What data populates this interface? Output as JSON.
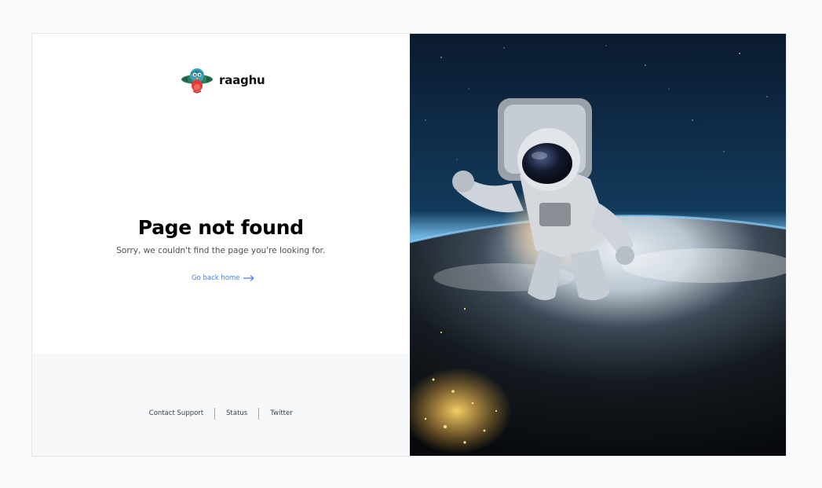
{
  "brand": {
    "name": "raaghu",
    "logo_icon": "parrot-mascot-logo"
  },
  "error": {
    "title": "Page not found",
    "message": "Sorry, we couldn't find the page you're looking for.",
    "home_link_label": "Go back home",
    "home_link_icon": "arrow-right-icon"
  },
  "footer": {
    "links": [
      {
        "label": "Contact Support"
      },
      {
        "label": "Status"
      },
      {
        "label": "Twitter"
      }
    ]
  },
  "hero_image": {
    "subject": "astronaut-floating-above-earth"
  },
  "colors": {
    "page_background": "#f9fafb",
    "panel_background": "#ffffff",
    "footer_background": "#f7f8fa",
    "link": "#3b82f6",
    "title": "#000000",
    "body_text": "#4b4f56"
  }
}
